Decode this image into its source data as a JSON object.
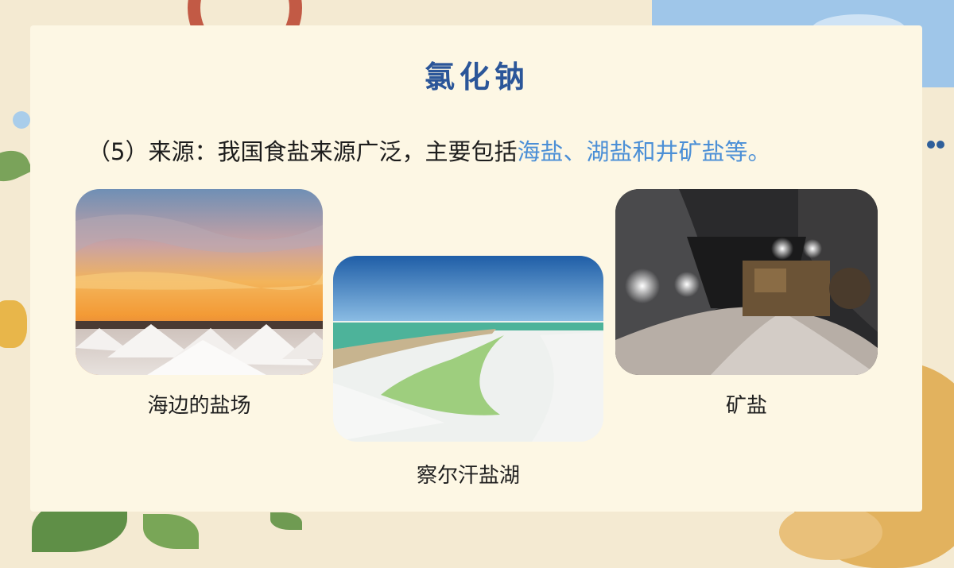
{
  "slide": {
    "title": "氯化钠",
    "intro_prefix": "（5）来源：我国食盐来源广泛，主要包括",
    "intro_highlight": "海盐、湖盐和井矿盐等。",
    "highlight_color": "#4b8fd6",
    "title_color": "#2b5699"
  },
  "photos": [
    {
      "caption": "海边的盐场",
      "subject": "salt-piles-at-sunset"
    },
    {
      "caption": "察尔汗盐湖",
      "subject": "salt-lake"
    },
    {
      "caption": "矿盐",
      "subject": "underground-salt-mine"
    }
  ]
}
